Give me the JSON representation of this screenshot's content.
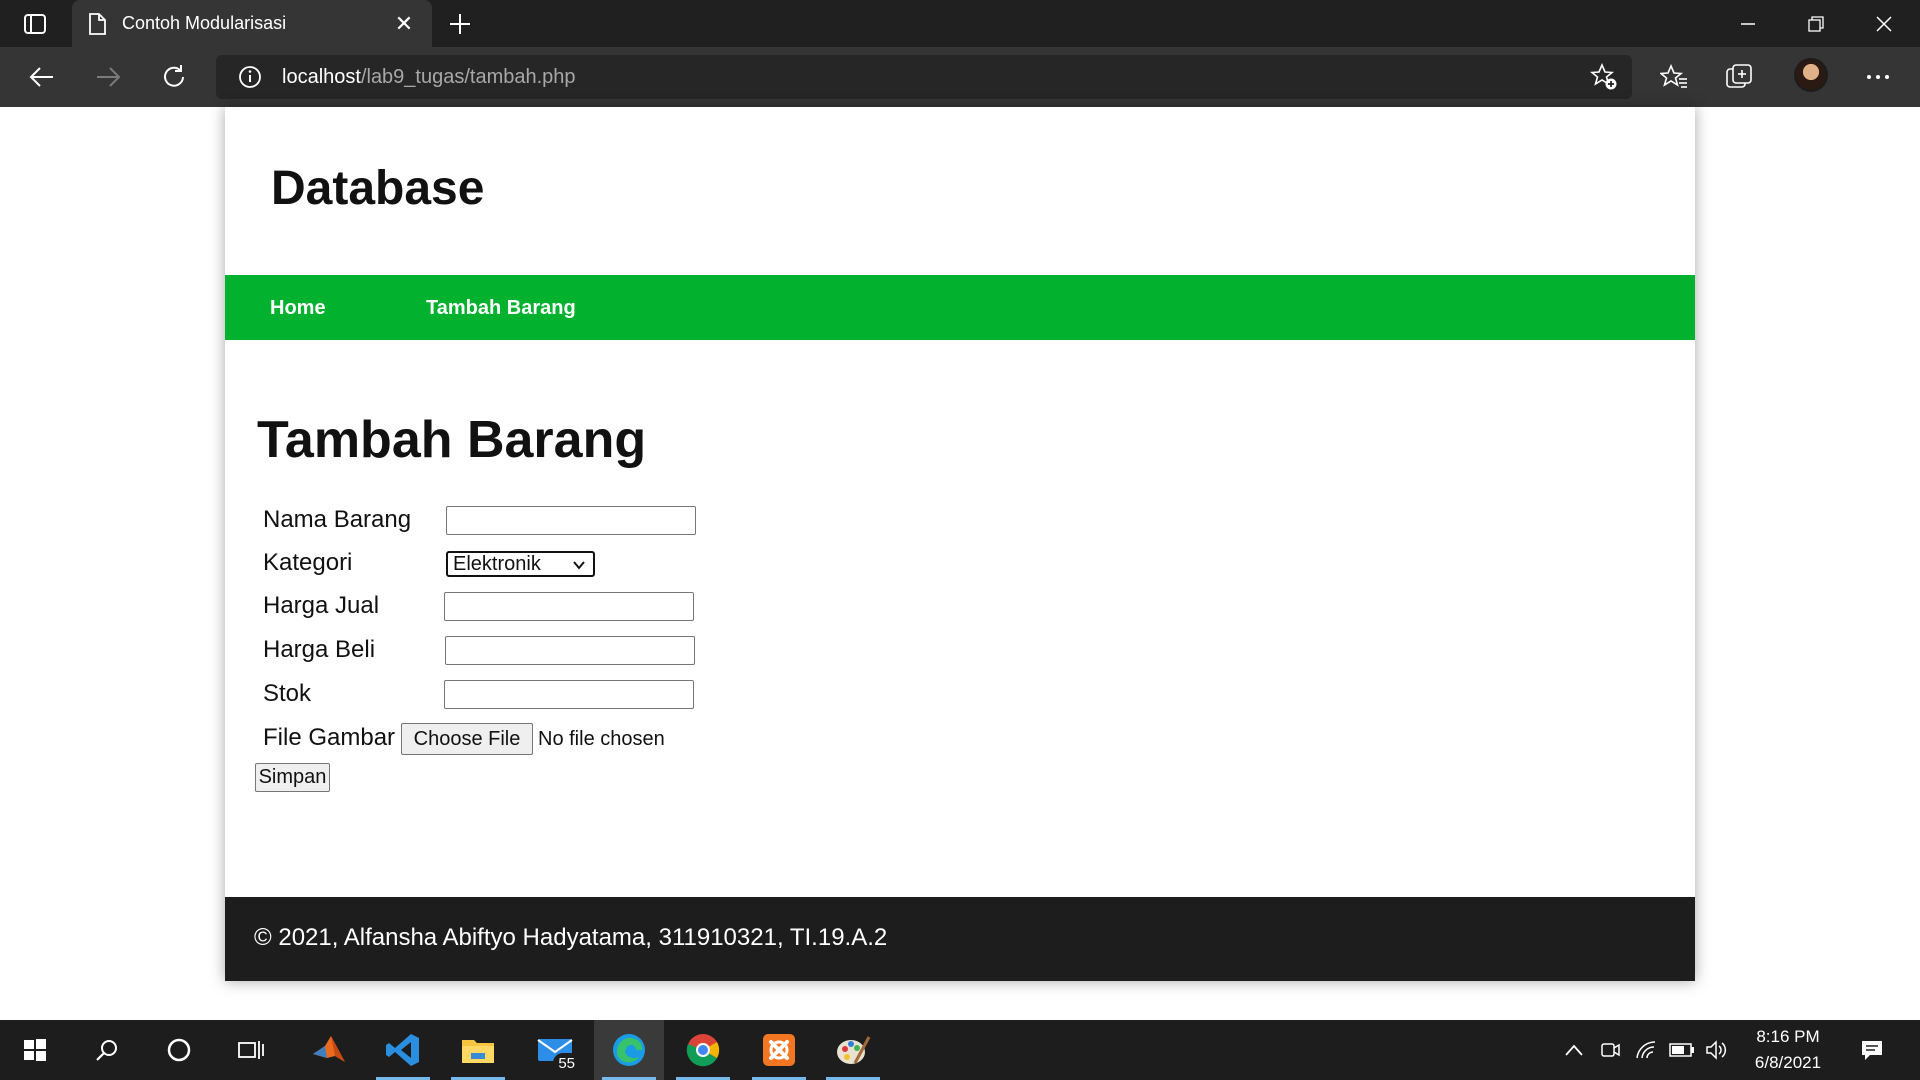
{
  "browser": {
    "tab_title": "Contoh Modularisasi",
    "tab_close": "✕",
    "url_host": "localhost",
    "url_path": "/lab9_tugas/tambah.php"
  },
  "page": {
    "site_title": "Database",
    "nav": [
      {
        "label": "Home"
      },
      {
        "label": "Tambah Barang"
      }
    ],
    "heading": "Tambah Barang",
    "form": {
      "nama_label": "Nama Barang",
      "nama_value": "",
      "kategori_label": "Kategori",
      "kategori_selected": "Elektronik",
      "harga_jual_label": "Harga Jual",
      "harga_jual_value": "",
      "harga_beli_label": "Harga Beli",
      "harga_beli_value": "",
      "stok_label": "Stok",
      "stok_value": "",
      "file_label": "File Gambar",
      "file_button": "Choose File",
      "file_status": "No file chosen",
      "submit": "Simpan"
    },
    "footer": "© 2021, Alfansha Abiftyo Hadyatama, 311910321, TI.19.A.2",
    "colors": {
      "nav_bg": "#02b22f",
      "footer_bg": "#1d1d1d"
    }
  },
  "taskbar": {
    "mail_badge": "55",
    "time": "8:16 PM",
    "date": "6/8/2021"
  }
}
